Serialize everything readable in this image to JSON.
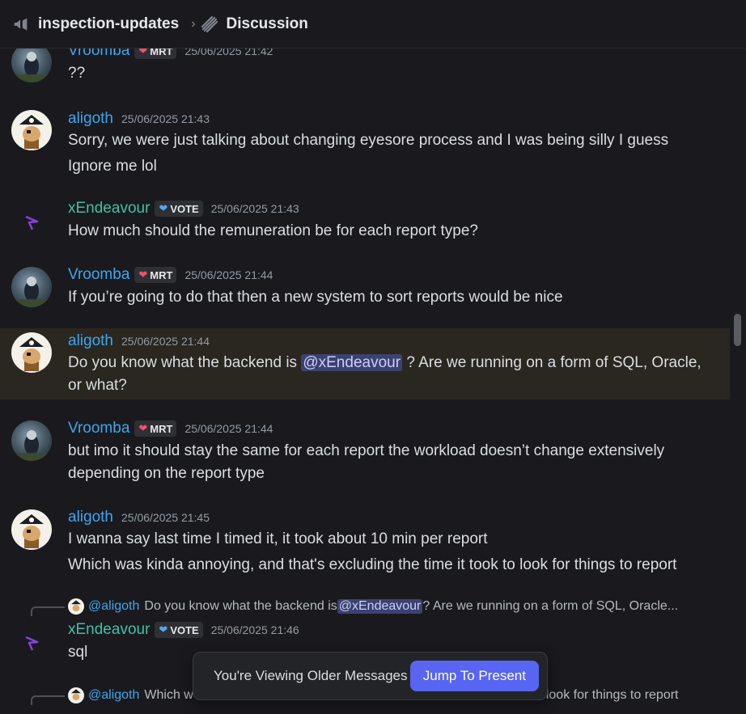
{
  "header": {
    "channel_icon": "megaphone-icon",
    "channel_name": "inspection-updates",
    "separator": "›",
    "thread_icon": "thread-icon",
    "thread_name": "Discussion"
  },
  "colors": {
    "background": "#1a1a1e",
    "username_blue": "#3ba7ef",
    "username_teal": "#3cc2a4",
    "mention_bg": "#3c4270",
    "accent": "#5865f2",
    "highlight_row": "#2a2620"
  },
  "messages": [
    {
      "author": "Vroomba",
      "badge": "MRT",
      "badge_icon": "heart-icon",
      "timestamp": "25/06/2025 21:42",
      "lines": [
        "??"
      ]
    },
    {
      "author": "aligoth",
      "timestamp": "25/06/2025 21:43",
      "lines": [
        "Sorry, we were just talking about changing eyesore process and I was being silly I guess",
        "Ignore me lol"
      ]
    },
    {
      "author": "xEndeavour",
      "badge": "VOTE",
      "badge_icon": "blue-heart-icon",
      "timestamp": "25/06/2025 21:43",
      "lines": [
        "How much should the remuneration be for each report type?"
      ]
    },
    {
      "author": "Vroomba",
      "badge": "MRT",
      "timestamp": "25/06/2025 21:44",
      "lines": [
        "If you’re going to do that then a new system to sort reports would be nice"
      ]
    },
    {
      "author": "aligoth",
      "timestamp": "25/06/2025 21:44",
      "text_before": "Do you know what the backend is ",
      "mention": "@xEndeavour",
      "text_after": " ?  Are we running on a form of SQL, Oracle, or what?"
    },
    {
      "author": "Vroomba",
      "badge": "MRT",
      "timestamp": "25/06/2025 21:44",
      "text": "but imo it should stay the same for each report the workload doesn’t change extensively depending on the report type"
    },
    {
      "author": "aligoth",
      "timestamp": "25/06/2025 21:45",
      "lines": [
        "I wanna say last time I timed it, it took about 10 min per report",
        "Which was kinda annoying, and that's excluding the time it took to look for things to report"
      ]
    },
    {
      "author": "xEndeavour",
      "badge": "VOTE",
      "timestamp": "25/06/2025 21:46",
      "lines": [
        "sql"
      ],
      "reply": {
        "author": "@aligoth",
        "text_before": "Do you know what the backend is ",
        "mention": "@xEndeavour",
        "text_after": " ?  Are we running on a form of SQL, Oracle..."
      }
    },
    {
      "reply": {
        "author": "@aligoth",
        "text_before": "Which w",
        "text_after": "look for things to report"
      }
    }
  ],
  "notice": {
    "text": "You're Viewing Older Messages",
    "button": "Jump To Present"
  }
}
